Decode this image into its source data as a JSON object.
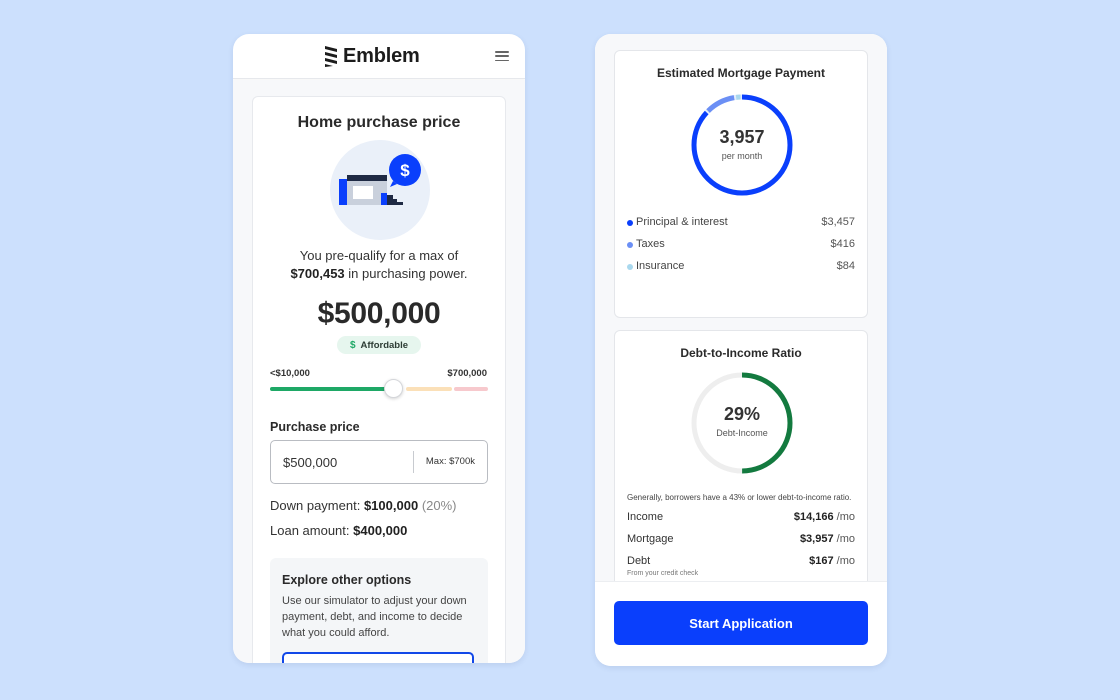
{
  "brand": {
    "name": "Emblem"
  },
  "left": {
    "title": "Home purchase price",
    "prequal": {
      "prefix": "You pre-qualify for a max of",
      "amount": "$700,453",
      "suffix": "in purchasing power."
    },
    "price": "$500,000",
    "badge": {
      "icon": "$",
      "label": "Affordable"
    },
    "range": {
      "min": "<$10,000",
      "max": "$700,000"
    },
    "purchase_price": {
      "label": "Purchase price",
      "value": "$500,000",
      "max_hint": "Max: $700k"
    },
    "down_payment": {
      "label": "Down payment:",
      "value": "$100,000",
      "percent": "(20%)"
    },
    "loan_amount": {
      "label": "Loan amount:",
      "value": "$400,000"
    },
    "explore": {
      "title": "Explore other options",
      "text": "Use our simulator to adjust your down payment, debt, and income to decide what you could afford."
    }
  },
  "right": {
    "mortgage": {
      "title": "Estimated Mortgage Payment",
      "amount": "3,957",
      "sub": "per month",
      "breakdown": [
        {
          "label": "Principal & interest",
          "value": "$3,457",
          "color": "#0a3ffc"
        },
        {
          "label": "Taxes",
          "value": "$416",
          "color": "#6b8ff5"
        },
        {
          "label": "Insurance",
          "value": "$84",
          "color": "#a9d8ee"
        }
      ]
    },
    "dti": {
      "title": "Debt-to-Income Ratio",
      "value": "29%",
      "sub": "Debt-Income",
      "note": "Generally, borrowers have a 43% or lower debt-to-income ratio.",
      "rows": [
        {
          "label": "Income",
          "value": "$14,166",
          "unit": "/mo"
        },
        {
          "label": "Mortgage",
          "value": "$3,957",
          "unit": "/mo"
        },
        {
          "label": "Debt",
          "value": "$167",
          "unit": "/mo"
        }
      ],
      "debt_sub": "From your credit check"
    },
    "cta": "Start Application"
  },
  "colors": {
    "primary": "#0a3ffc",
    "success": "#1ea866",
    "dti_ring": "#137a3f",
    "background": "#cce0fd"
  }
}
